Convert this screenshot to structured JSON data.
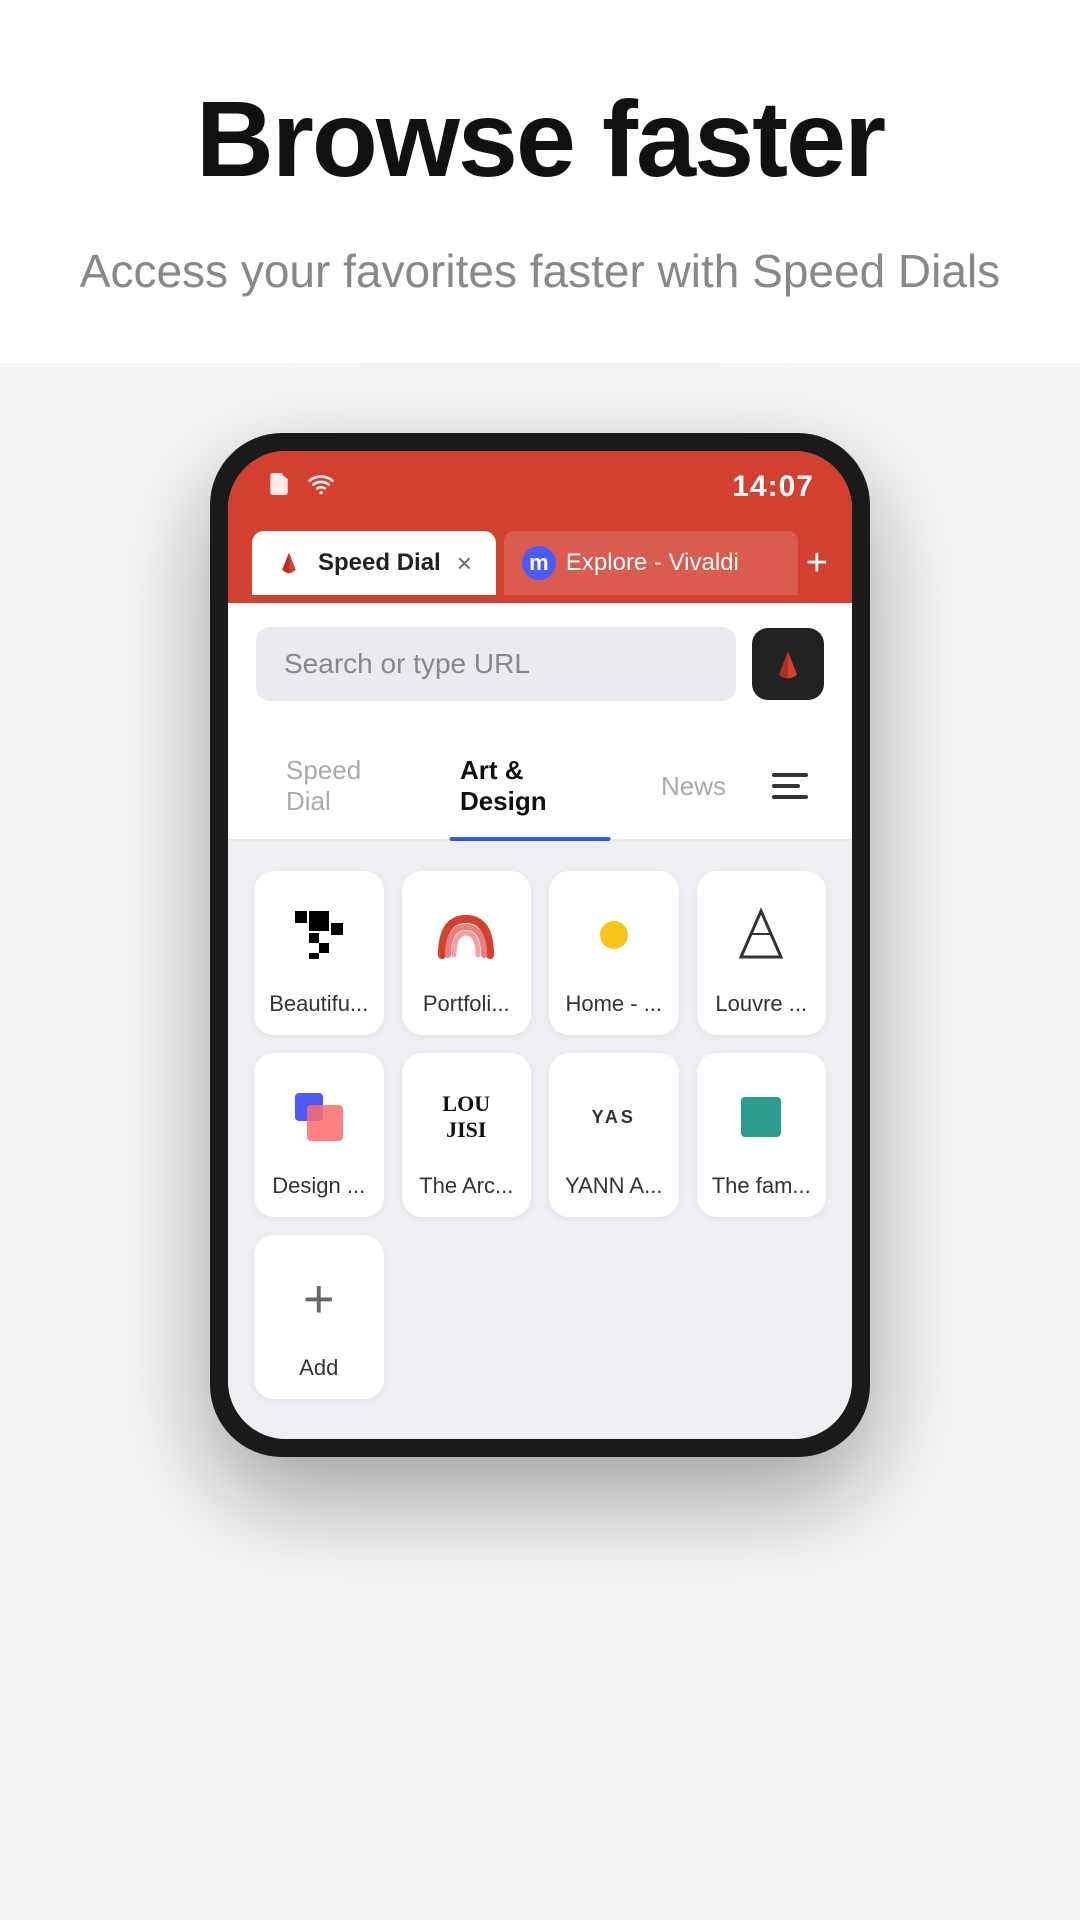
{
  "hero": {
    "title": "Browse faster",
    "subtitle": "Access your favorites faster with Speed Dials"
  },
  "status_bar": {
    "time": "14:07",
    "icons": [
      "document-icon",
      "wifi-icon"
    ]
  },
  "tabs": {
    "active": {
      "label": "Speed Dial",
      "close_btn": "×"
    },
    "inactive": {
      "label": "Explore - Vivaldi",
      "m_letter": "m"
    },
    "new_btn": "+"
  },
  "search": {
    "placeholder": "Search or type URL"
  },
  "nav": {
    "tabs": [
      {
        "label": "Speed Dial",
        "active": false
      },
      {
        "label": "Art & Design",
        "active": true
      },
      {
        "label": "News",
        "active": false
      }
    ]
  },
  "speed_dial": {
    "items": [
      {
        "label": "Beautifu...",
        "color": "#000"
      },
      {
        "label": "Portfoli...",
        "color": "#e84040"
      },
      {
        "label": "Home - ...",
        "color": "#f5c518"
      },
      {
        "label": "Louvre ...",
        "color": "#333"
      },
      {
        "label": "Design ...",
        "color": "#4a5aff"
      },
      {
        "label": "The Arc...",
        "color": "#111"
      },
      {
        "label": "YANN A...",
        "color": "#333"
      },
      {
        "label": "The fam...",
        "color": "#2a9d8f"
      }
    ],
    "add_label": "Add"
  }
}
